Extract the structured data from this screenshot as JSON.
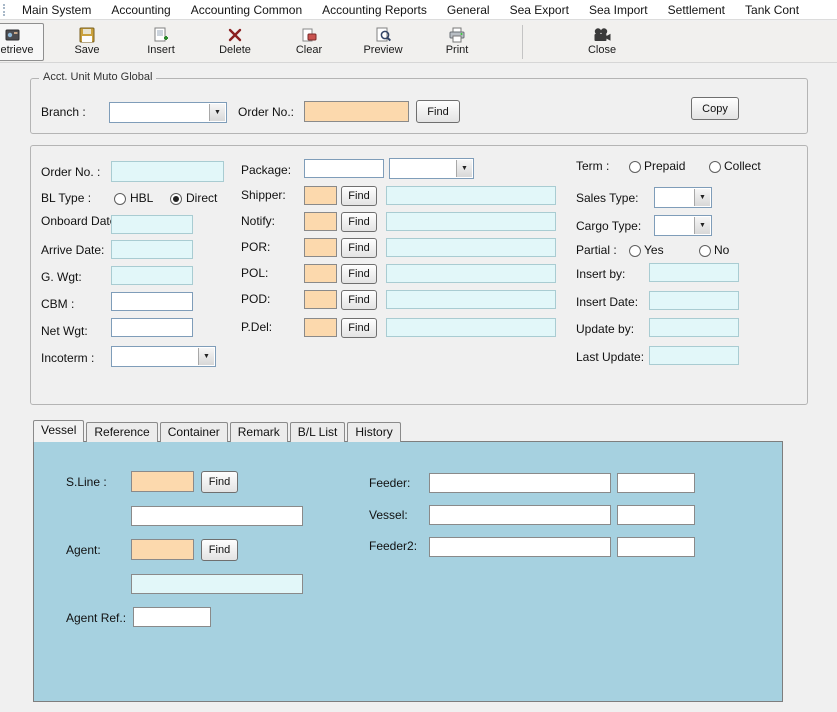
{
  "menu": {
    "items": [
      "Main System",
      "Accounting",
      "Accounting Common",
      "Accounting Reports",
      "General",
      "Sea Export",
      "Sea Import",
      "Settlement",
      "Tank Cont"
    ]
  },
  "toolbar": {
    "retrieve": "Retrieve",
    "save": "Save",
    "insert": "Insert",
    "delete": "Delete",
    "clear": "Clear",
    "preview": "Preview",
    "print": "Print",
    "close": "Close"
  },
  "acct_group": {
    "title": "Acct. Unit Muto Global",
    "branch_label": "Branch :",
    "order_no_label": "Order No.:",
    "find_label": "Find",
    "copy_label": "Copy",
    "values": {
      "branch": "",
      "order_no": ""
    }
  },
  "form": {
    "order_no_label": "Order No. :",
    "bl_type_label": "BL Type :",
    "bl_hbl": "HBL",
    "bl_direct": "Direct",
    "onboard_date_label": "Onboard Date:",
    "arrive_date_label": "Arrive Date:",
    "g_wgt_label": "G. Wgt:",
    "cbm_label": "CBM :",
    "net_wgt_label": "Net Wgt:",
    "incoterm_label": "Incoterm :",
    "package_label": "Package:",
    "shipper_label": "Shipper:",
    "notify_label": "Notify:",
    "por_label": "POR:",
    "pol_label": "POL:",
    "pod_label": "POD:",
    "pdel_label": "P.Del:",
    "find_label": "Find",
    "term_label": "Term :",
    "term_prepaid": "Prepaid",
    "term_collect": "Collect",
    "sales_type_label": "Sales Type:",
    "cargo_type_label": "Cargo Type:",
    "partial_label": "Partial :",
    "partial_yes": "Yes",
    "partial_no": "No",
    "insert_by_label": "Insert by:",
    "insert_date_label": "Insert Date:",
    "update_by_label": "Update by:",
    "last_update_label": "Last Update:",
    "radio_state": {
      "bl_type": "Direct",
      "term": "",
      "partial": ""
    },
    "values": {
      "order_no": "",
      "onboard_date": "",
      "arrive_date": "",
      "g_wgt": "",
      "cbm": "",
      "net_wgt": "",
      "incoterm": "",
      "package_qty": "",
      "package_unit": "",
      "shipper_code": "",
      "shipper_name": "",
      "notify_code": "",
      "notify_name": "",
      "por_code": "",
      "por_name": "",
      "pol_code": "",
      "pol_name": "",
      "pod_code": "",
      "pod_name": "",
      "pdel_code": "",
      "pdel_name": "",
      "sales_type": "",
      "cargo_type": "",
      "insert_by": "",
      "insert_date": "",
      "update_by": "",
      "last_update": ""
    }
  },
  "tabs": {
    "items": [
      "Vessel",
      "Reference",
      "Container",
      "Remark",
      "B/L List",
      "History"
    ],
    "active": "Vessel"
  },
  "vessel_tab": {
    "sline_label": "S.Line :",
    "agent_label": "Agent:",
    "agent_ref_label": "Agent Ref.:",
    "feeder_label": "Feeder:",
    "vessel_label": "Vessel:",
    "feeder2_label": "Feeder2:",
    "find_label": "Find",
    "values": {
      "sline_code": "",
      "sline_name": "",
      "agent_code": "",
      "agent_name": "",
      "agent_ref": "",
      "feeder": "",
      "feeder_voyage": "",
      "vessel": "",
      "vessel_voyage": "",
      "feeder2": "",
      "feeder2_voyage": ""
    }
  },
  "colors": {
    "input_cyan": "#e2f7f9",
    "input_orange": "#fcd9ad",
    "panel_blue": "#a6d1e0",
    "page_bg": "#f0f0f0"
  }
}
